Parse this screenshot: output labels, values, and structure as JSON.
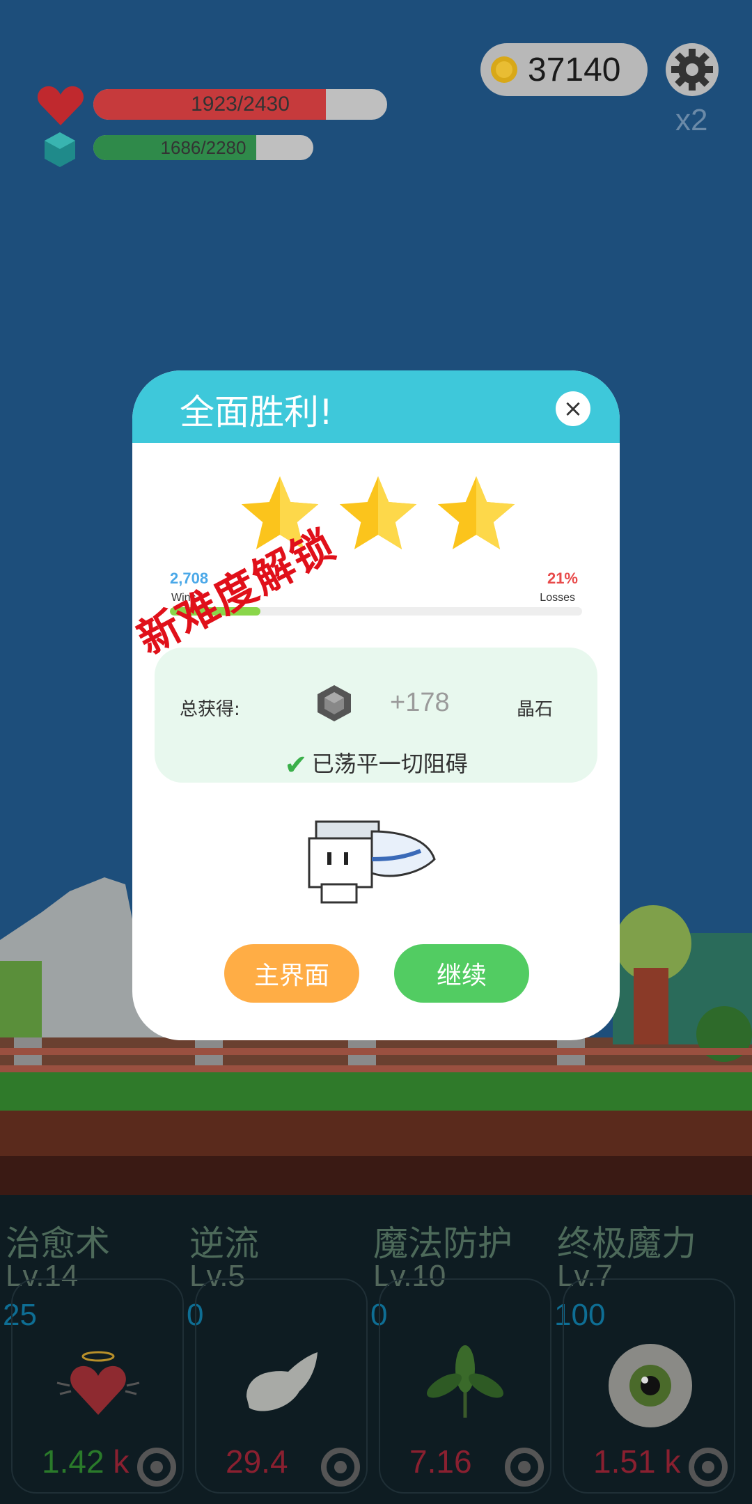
{
  "hud": {
    "health": {
      "text": "1923/2430",
      "value": 1923,
      "max": 2430,
      "color": "#c63a3c"
    },
    "mana": {
      "text": "1686/2280",
      "value": 1686,
      "max": 2280,
      "color": "#2f8a4a"
    },
    "coins": "37140",
    "speed_multiplier": "x2",
    "icons": {
      "health": "heart-icon",
      "mana": "gem-icon",
      "coin": "coin-icon",
      "settings": "gear-icon"
    }
  },
  "modal": {
    "title": "全面胜利!",
    "close_label": "×",
    "stars_earned": 3,
    "stars_total": 3,
    "wins_value": "2,708",
    "wins_label": "Wins",
    "losses_value": "21%",
    "losses_label": "Losses",
    "win_ratio": 0.22,
    "stamp_text": "新难度解锁",
    "reward": {
      "label": "总获得:",
      "amount": "+178",
      "unit": "晶石",
      "icon": "crystal-icon"
    },
    "cleared_text": "已荡平一切阻碍",
    "buttons": {
      "home": "主界面",
      "continue": "继续"
    }
  },
  "skills": [
    {
      "name": "治愈术",
      "level": "Lv.14",
      "count": "25",
      "cost_num": "1.42",
      "cost_unit": "k",
      "icon": "winged-heart-icon"
    },
    {
      "name": "逆流",
      "level": "Lv.5",
      "count": "0",
      "cost_num": "29.4",
      "cost_unit": "",
      "icon": "wing-icon"
    },
    {
      "name": "魔法防护",
      "level": "Lv.10",
      "count": "0",
      "cost_num": "7.16",
      "cost_unit": "",
      "icon": "leaf-icon"
    },
    {
      "name": "终极魔力",
      "level": "Lv.7",
      "count": "100",
      "cost_num": "1.51",
      "cost_unit": "k",
      "icon": "eye-icon"
    }
  ],
  "colors": {
    "accent": "#3ec8da",
    "home_button": "#ffad45",
    "continue_button": "#52cc62",
    "stamp": "#e0101a"
  }
}
